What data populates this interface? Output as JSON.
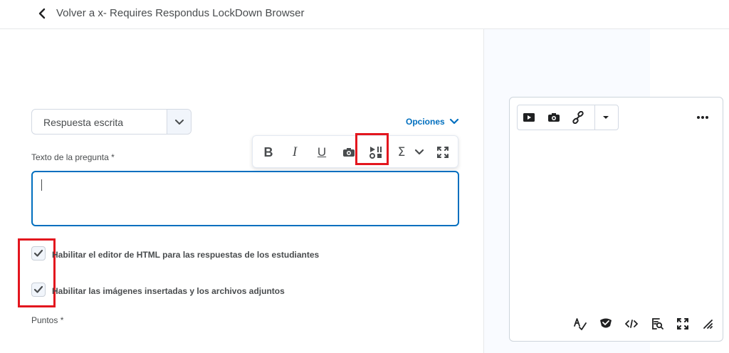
{
  "header": {
    "back_title": "Volver a x- Requires Respondus LockDown Browser",
    "back_icon": "chevron-left-icon"
  },
  "question_type": {
    "selected": "Respuesta escrita"
  },
  "options_link": "Opciones",
  "question_text": {
    "label": "Texto de la pregunta *",
    "value": ""
  },
  "toolbar": {
    "bold": "B",
    "italic": "I",
    "underline": "U",
    "sigma": "Σ",
    "icons": [
      "bold-icon",
      "italic-icon",
      "underline-icon",
      "insert-image-icon",
      "insert-media-icon",
      "equation-icon",
      "chevron-down-icon",
      "fullscreen-icon"
    ]
  },
  "checkboxes": [
    {
      "label": "Habilitar el editor de HTML para las respuestas de los estudiantes",
      "checked": true
    },
    {
      "label": "Habilitar las imágenes insertadas y los archivos adjuntos",
      "checked": true
    }
  ],
  "points_label": "Puntos *",
  "right_editor": {
    "top_icons": [
      "play-video-icon",
      "insert-image-icon",
      "link-icon",
      "caret-down-icon",
      "more-options-icon"
    ],
    "bottom_icons": [
      "spellcheck-icon",
      "accessibility-check-icon",
      "source-code-icon",
      "preview-icon",
      "fullscreen-icon",
      "resize-handle-icon"
    ]
  },
  "colors": {
    "accent": "#006fbf",
    "highlight": "#e3161e",
    "text": "#494c4e"
  }
}
